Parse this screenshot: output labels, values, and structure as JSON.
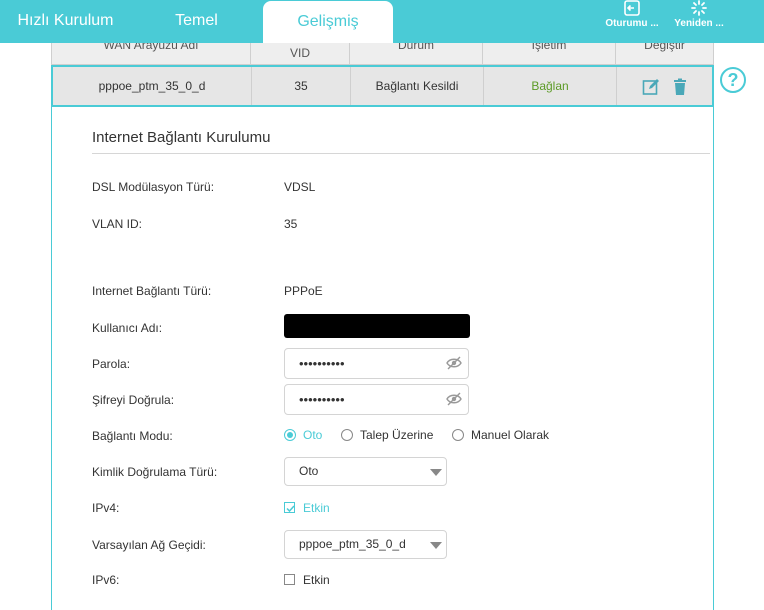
{
  "nav": {
    "tabs": [
      {
        "label": "Hızlı Kurulum"
      },
      {
        "label": "Temel"
      },
      {
        "label": "Gelişmiş"
      }
    ],
    "logout_label": "Oturumu ...",
    "reboot_label": "Yeniden ..."
  },
  "help_label": "?",
  "table": {
    "headers": [
      "WAN Arayüzü Adı",
      "VID",
      "Durum",
      "İşletim",
      "Değiştir"
    ],
    "row": {
      "name": "pppoe_ptm_35_0_d",
      "vid": "35",
      "status": "Bağlantı Kesildi",
      "action": "Bağlan"
    }
  },
  "panel": {
    "title": "Internet Bağlantı Kurulumu",
    "fields": {
      "dsl_label": "DSL Modülasyon Türü:",
      "dsl_value": "VDSL",
      "vlan_label": "VLAN ID:",
      "vlan_value": "35",
      "conn_type_label": "Internet Bağlantı Türü:",
      "conn_type_value": "PPPoE",
      "username_label": "Kullanıcı Adı:",
      "password_label": "Parola:",
      "password_value": "••••••••••",
      "confirm_label": "Şifreyi Doğrula:",
      "confirm_value": "••••••••••",
      "mode_label": "Bağlantı Modu:",
      "mode_options": [
        "Oto",
        "Talep Üzerine",
        "Manuel Olarak"
      ],
      "auth_label": "Kimlik Doğrulama Türü:",
      "auth_value": "Oto",
      "ipv4_label": "IPv4:",
      "ipv4_check": "Etkin",
      "gateway_label": "Varsayılan Ağ Geçidi:",
      "gateway_value": "pppoe_ptm_35_0_d",
      "ipv6_label": "IPv6:",
      "ipv6_check": "Etkin"
    }
  },
  "colors": {
    "accent": "#4acbd6",
    "connect_green": "#5c9b26"
  }
}
